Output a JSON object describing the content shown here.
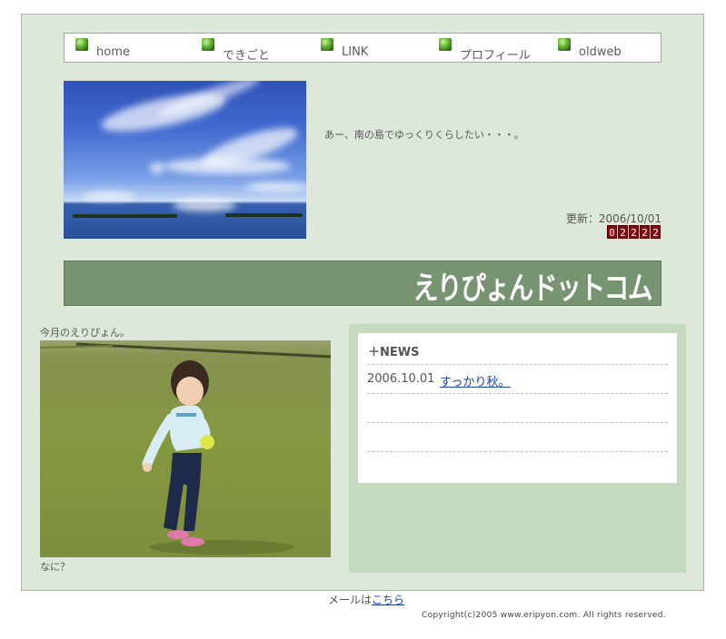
{
  "nav": {
    "items": [
      {
        "label": "home",
        "icon": "green-square-icon"
      },
      {
        "label": "できごと",
        "icon": "green-square-icon"
      },
      {
        "label": "LINK",
        "icon": "green-square-icon"
      },
      {
        "label": "プロフィール",
        "icon": "green-square-icon"
      },
      {
        "label": "oldweb",
        "icon": "green-square-icon"
      }
    ]
  },
  "header": {
    "tagline": "あー、南の島でゆっくりくらしたい・・・。",
    "updated": "更新：2006/10/01",
    "counter": [
      "0",
      "2",
      "2",
      "2",
      "2"
    ]
  },
  "banner": {
    "title": "えりぴょんドットコム"
  },
  "feature": {
    "label": "今月のえりぴょん。",
    "caption": "なに？"
  },
  "news": {
    "heading": "＋NEWS",
    "items": [
      {
        "date": "2006.10.01",
        "title": "すっかり秋。"
      }
    ]
  },
  "footer": {
    "mail_prefix": "メールは",
    "mail_link": "こちら",
    "copyright": "Copyright(c)2005 www.eripyon.com. All rights reserved."
  },
  "colors": {
    "page_background": "#dde8db",
    "banner": "#76946f",
    "news_panel": "#c3dabe",
    "counter": "#8a0a0a",
    "link": "#1a3fb0"
  }
}
